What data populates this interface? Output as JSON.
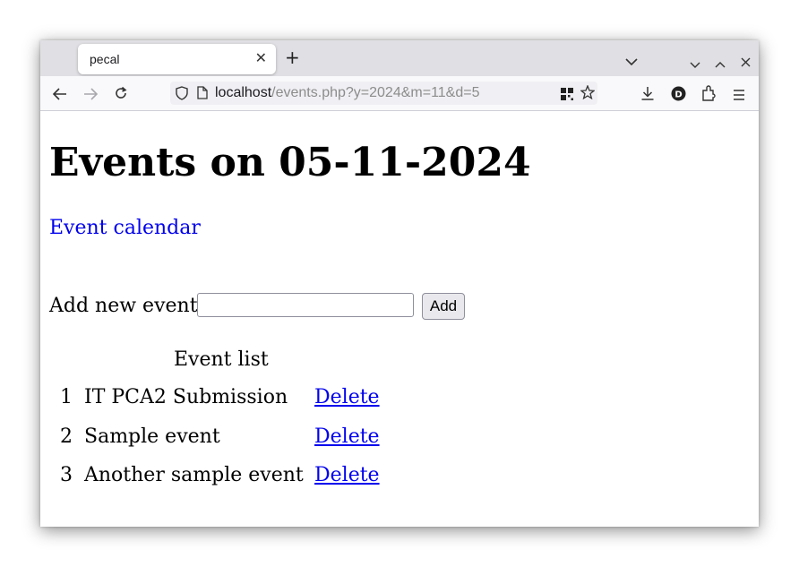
{
  "browser": {
    "tab_title": "pecal",
    "url_host": "localhost",
    "url_path": "/events.php?y=2024&m=11&d=5"
  },
  "page": {
    "heading": "Events on 05-11-2024",
    "calendar_link": "Event calendar",
    "add_label": "Add new event:",
    "add_input_value": "",
    "add_button": "Add",
    "list_caption": "Event list",
    "events": [
      {
        "num": "1",
        "name": "IT PCA2 Submission",
        "delete_label": "Delete"
      },
      {
        "num": "2",
        "name": "Sample event",
        "delete_label": "Delete"
      },
      {
        "num": "3",
        "name": "Another sample event",
        "delete_label": "Delete"
      }
    ]
  },
  "colors": {
    "link": "#0000ee",
    "tabbar_bg": "#e0e0e4",
    "navbar_bg": "#f9f9fb"
  },
  "icons": [
    "close-icon",
    "new-tab-icon",
    "tab-list-icon",
    "minimize-icon",
    "maximize-icon",
    "window-close-icon",
    "back-icon",
    "forward-icon",
    "reload-icon",
    "shield-icon",
    "page-icon",
    "qr-code-icon",
    "bookmark-star-icon",
    "download-icon",
    "profile-icon",
    "extensions-icon",
    "menu-icon"
  ]
}
